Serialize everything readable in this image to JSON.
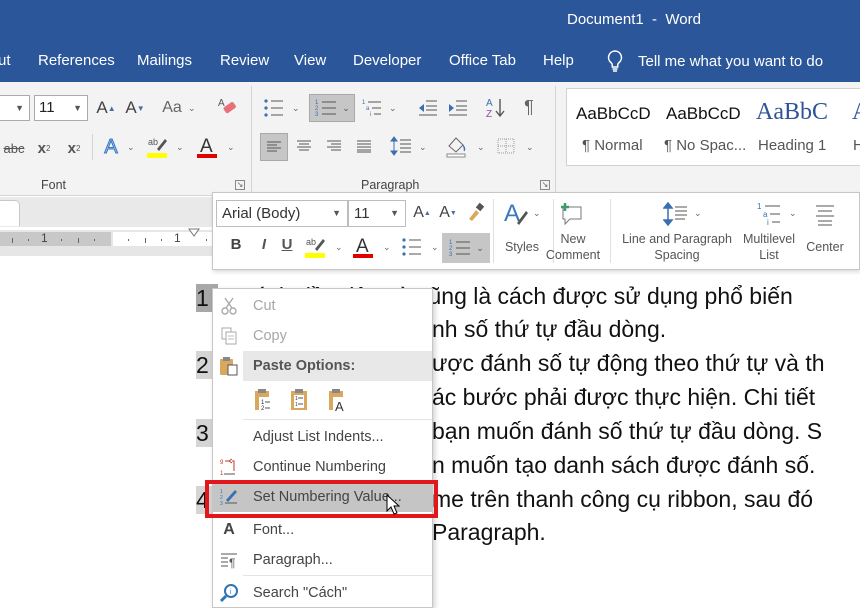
{
  "window": {
    "title": "Document1  -  Word"
  },
  "tabs": [
    {
      "label": "ut"
    },
    {
      "label": "References"
    },
    {
      "label": "Mailings"
    },
    {
      "label": "Review"
    },
    {
      "label": "View"
    },
    {
      "label": "Developer"
    },
    {
      "label": "Office Tab"
    },
    {
      "label": "Help"
    }
  ],
  "tell_me": {
    "placeholder": "Tell me what you want to do",
    "icon": "lightbulb-icon"
  },
  "ribbon": {
    "font_group": {
      "label": "Font",
      "font_size": "11",
      "buttons": [
        "grow-font",
        "shrink-font",
        "change-case",
        "clear-formatting",
        "strikethrough",
        "subscript",
        "superscript",
        "text-effects",
        "text-highlight-color",
        "font-color"
      ],
      "change_case_label": "Aa",
      "highlight_color": "#ffff00",
      "font_color": "#e00000"
    },
    "paragraph_group": {
      "label": "Paragraph",
      "buttons": [
        "bullets",
        "numbering",
        "multilevel-list",
        "decrease-indent",
        "increase-indent",
        "sort",
        "show-marks",
        "align-left",
        "center",
        "align-right",
        "justify",
        "line-spacing",
        "shading",
        "borders"
      ],
      "active": [
        "numbering",
        "align-left"
      ]
    },
    "styles_group": {
      "items": [
        {
          "preview": "AaBbCcD",
          "name": "¶ Normal"
        },
        {
          "preview": "AaBbCcD",
          "name": "¶ No Spac..."
        },
        {
          "preview": "AaBbC",
          "name": "Heading 1"
        },
        {
          "preview": "A",
          "name": "H"
        }
      ]
    }
  },
  "ruler": {
    "labels": [
      "1",
      "1"
    ]
  },
  "document": {
    "list_numbers": [
      "1",
      "2",
      "3",
      "4"
    ],
    "lines": [
      "Cách đầu tiên và cũng là cách được sử dụng phổ biến",
      "nh số thứ tự đầu dòng.",
      "ược đánh số tự động theo thứ tự và th",
      "ác bước phải được thực hiện. Chi tiết",
      "bạn muốn đánh số thứ tự đầu dòng. S",
      "n muốn tạo danh sách được đánh số.",
      "me trên thanh công cụ ribbon, sau đó",
      "Paragraph."
    ]
  },
  "mini_toolbar": {
    "font_name": "Arial (Body)",
    "font_size": "11",
    "styles_label": "Styles",
    "new_comment_label": [
      "New",
      "Comment"
    ],
    "line_spacing_label": [
      "Line and Paragraph",
      "Spacing"
    ],
    "multilevel_label": [
      "Multilevel",
      "List"
    ],
    "center_label": "Center",
    "highlight_color": "#ffff00",
    "font_color": "#e00000"
  },
  "context_menu": {
    "items": [
      {
        "label": "Cut",
        "icon": "scissors-icon",
        "enabled": false
      },
      {
        "label": "Copy",
        "icon": "copy-icon",
        "enabled": false
      },
      {
        "label": "Paste Options:",
        "icon": "paste-icon",
        "header": true
      },
      {
        "label": "Adjust List Indents...",
        "enabled": true
      },
      {
        "label": "Continue Numbering",
        "icon": "continue-numbering-icon",
        "enabled": true
      },
      {
        "label": "Set Numbering Value...",
        "icon": "set-numbering-value-icon",
        "enabled": true,
        "hovered": true
      },
      {
        "label": "Font...",
        "icon": "font-icon",
        "enabled": true
      },
      {
        "label": "Paragraph...",
        "icon": "paragraph-icon",
        "enabled": true
      },
      {
        "label": "Search \"Cách\"",
        "icon": "search-icon",
        "enabled": true
      }
    ],
    "paste_options": [
      "keep-source-formatting",
      "merge-list",
      "keep-text-only"
    ],
    "highlight_color": "#e2171b"
  }
}
